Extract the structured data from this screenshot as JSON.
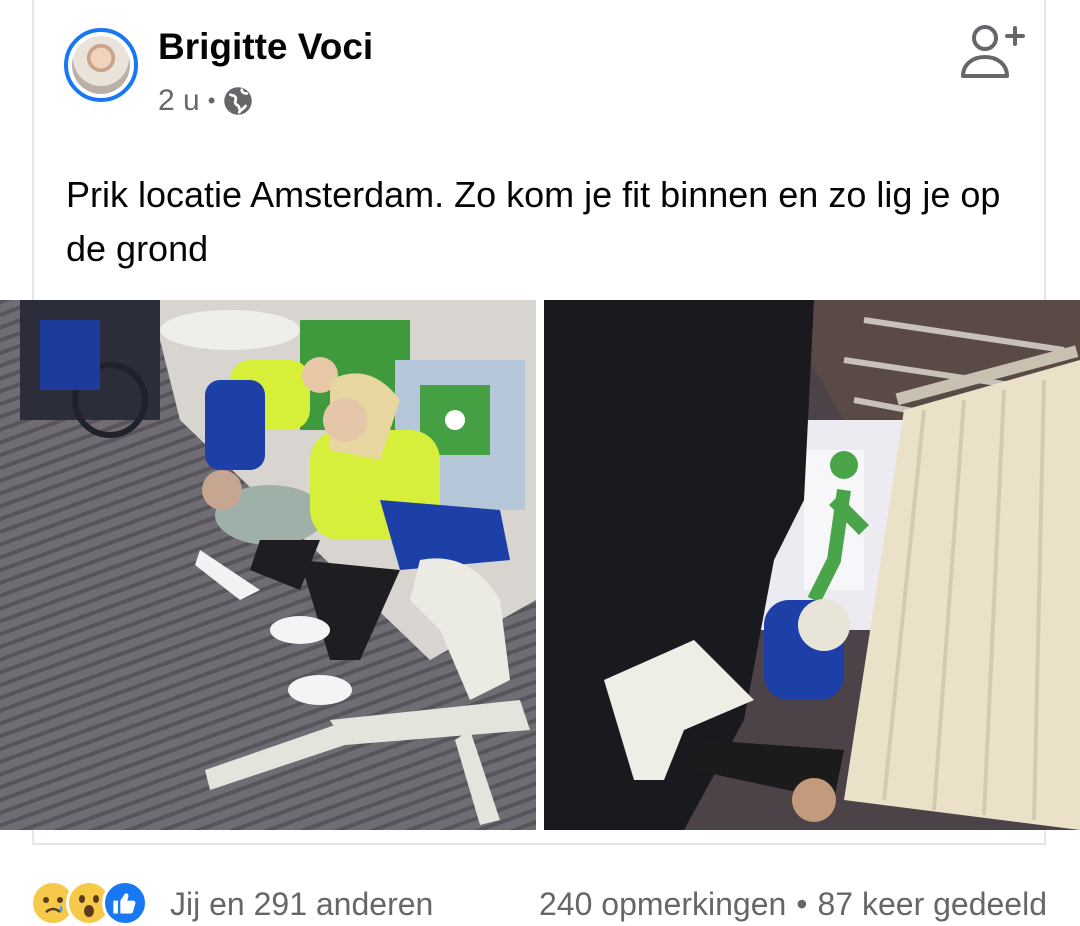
{
  "post": {
    "author": "Brigitte Voci",
    "time": "2 u",
    "separator": "•",
    "audience_icon": "globe-icon",
    "text": "Prik locatie Amsterdam. Zo kom je fit binnen en zo lig je op de grond"
  },
  "header": {
    "add_friend_icon": "add-friend-icon"
  },
  "footer": {
    "reaction_icons": [
      "sad-reaction-icon",
      "wow-reaction-icon",
      "like-reaction-icon"
    ],
    "reaction_text": "Jij en 291 anderen",
    "comments": "240 opmerkingen",
    "separator": "•",
    "shares": "87 keer gedeeld"
  },
  "colors": {
    "accent": "#1877f2",
    "secondary_text": "#65676b",
    "reaction_yellow": "#f7c948"
  }
}
